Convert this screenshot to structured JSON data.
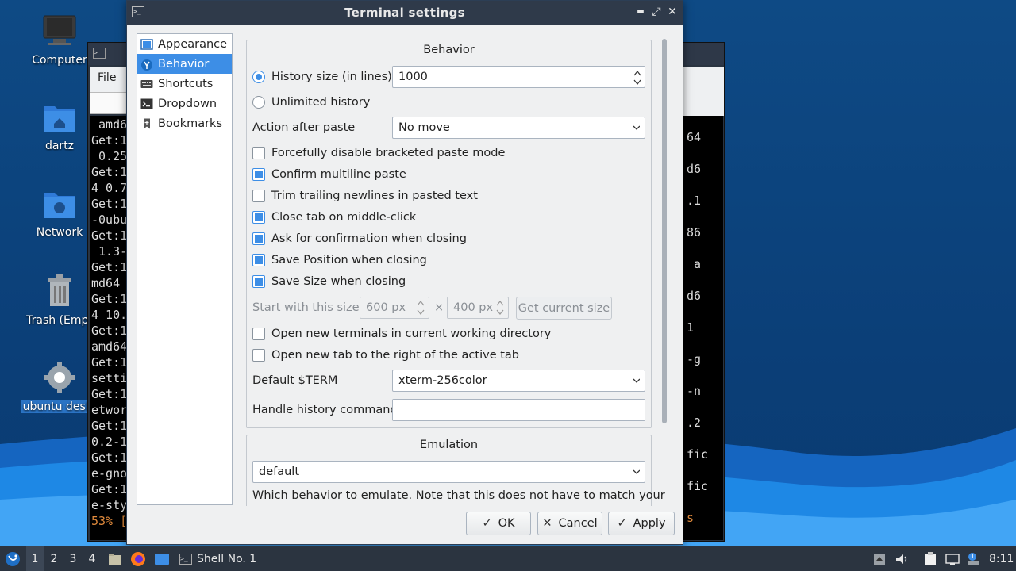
{
  "desktop": {
    "icons": [
      {
        "label": "Computer"
      },
      {
        "label": "dartz"
      },
      {
        "label": "Network"
      },
      {
        "label": "Trash (Empt"
      },
      {
        "label": "ubuntu deskt"
      }
    ]
  },
  "background_terminal": {
    "menu_file": "File",
    "left_lines": [
      " amd6",
      "Get:1",
      " 0.25",
      "Get:1",
      "4 0.7",
      "Get:1",
      "-0ubu",
      "Get:1",
      " 1.3-",
      "Get:1",
      "md64 ",
      "Get:1",
      "4 10.",
      "Get:1",
      "amd64",
      "Get:1",
      "setti",
      "Get:1",
      "etwor",
      "Get:1",
      "0.2-1",
      "Get:1",
      "e-gno",
      "Get:1",
      "e-sty",
      "53% ["
    ],
    "right_lines": [
      "64",
      "d6",
      ".1",
      "86",
      " a",
      "d6",
      "1",
      "-g",
      "-n",
      ".2",
      "fic",
      "fic",
      "s"
    ]
  },
  "dialog": {
    "title": "Terminal settings",
    "minimize": "▬",
    "maximize": "⤢",
    "close": "✕",
    "sidebar": [
      {
        "label": "Appearance",
        "icon": "appearance-icon"
      },
      {
        "label": "Behavior",
        "icon": "behavior-icon"
      },
      {
        "label": "Shortcuts",
        "icon": "keyboard-icon"
      },
      {
        "label": "Dropdown",
        "icon": "terminal-icon"
      },
      {
        "label": "Bookmarks",
        "icon": "bookmark-icon"
      }
    ],
    "behavior": {
      "group_title": "Behavior",
      "history_size_label": "History size (in lines)",
      "history_size_value": "1000",
      "unlimited_history_label": "Unlimited history",
      "action_after_paste_label": "Action after paste",
      "action_after_paste_value": "No move",
      "checkboxes": [
        {
          "label": "Forcefully disable bracketed paste mode",
          "checked": false
        },
        {
          "label": "Confirm multiline paste",
          "checked": true
        },
        {
          "label": "Trim trailing newlines in pasted text",
          "checked": false
        },
        {
          "label": "Close tab on middle-click",
          "checked": true
        },
        {
          "label": "Ask for confirmation when closing",
          "checked": true
        },
        {
          "label": "Save Position when closing",
          "checked": true
        },
        {
          "label": "Save Size when closing",
          "checked": true
        }
      ],
      "start_size_label": "Start with this size:",
      "start_width": "600 px",
      "times": "×",
      "start_height": "400 px",
      "get_current_size": "Get current size",
      "checkboxes2": [
        {
          "label": "Open new terminals in current working directory",
          "checked": false
        },
        {
          "label": "Open new tab to the right of the active tab",
          "checked": false
        }
      ],
      "default_term_label": "Default $TERM",
      "default_term_value": "xterm-256color",
      "handle_history_label": "Handle history command",
      "handle_history_value": ""
    },
    "emulation": {
      "group_title": "Emulation",
      "value": "default",
      "note": "Which behavior to emulate. Note that this does not have to match your"
    },
    "buttons": {
      "ok": "OK",
      "cancel": "Cancel",
      "apply": "Apply"
    }
  },
  "taskbar": {
    "workspaces": [
      "1",
      "2",
      "3",
      "4"
    ],
    "active_workspace": "1",
    "task_label": "Shell No. 1",
    "clock": "8:11"
  },
  "colors": {
    "accent": "#3d8ee6",
    "titlebar": "#2f3a4a",
    "taskbar": "#2b3440",
    "desktop": "#0e4a85"
  }
}
